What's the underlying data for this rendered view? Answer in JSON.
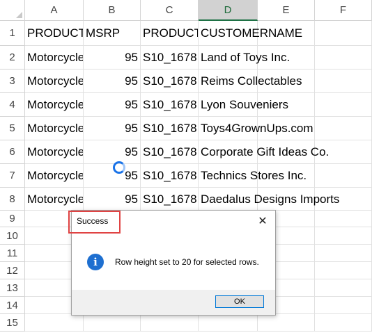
{
  "columns": [
    "A",
    "B",
    "C",
    "D",
    "E",
    "F"
  ],
  "selected_column": "D",
  "rows": [
    "1",
    "2",
    "3",
    "4",
    "5",
    "6",
    "7",
    "8",
    "9",
    "10",
    "11",
    "12",
    "13",
    "14",
    "15"
  ],
  "header_row": {
    "A": "PRODUCTLINE",
    "B": "MSRP",
    "C": "PRODUCTCODE",
    "D": "CUSTOMERNAME"
  },
  "data_rows": [
    {
      "A": "Motorcycles",
      "B": "95",
      "C": "S10_1678",
      "D": "Land of Toys Inc."
    },
    {
      "A": "Motorcycles",
      "B": "95",
      "C": "S10_1678",
      "D": "Reims Collectables"
    },
    {
      "A": "Motorcycles",
      "B": "95",
      "C": "S10_1678",
      "D": "Lyon Souveniers"
    },
    {
      "A": "Motorcycles",
      "B": "95",
      "C": "S10_1678",
      "D": "Toys4GrownUps.com"
    },
    {
      "A": "Motorcycles",
      "B": "95",
      "C": "S10_1678",
      "D": "Corporate Gift Ideas Co."
    },
    {
      "A": "Motorcycles",
      "B": "95",
      "C": "S10_1678",
      "D": "Technics Stores Inc."
    },
    {
      "A": "Motorcycles",
      "B": "95",
      "C": "S10_1678",
      "D": "Daedalus Designs Imports"
    }
  ],
  "dialog": {
    "title": "Success",
    "close_glyph": "✕",
    "icon_glyph": "i",
    "message": "Row height set to 20 for selected rows.",
    "ok_label": "OK"
  },
  "colors": {
    "selection_green": "#1e7145",
    "info_blue": "#1e6fd0",
    "highlight_red": "#e04343"
  }
}
